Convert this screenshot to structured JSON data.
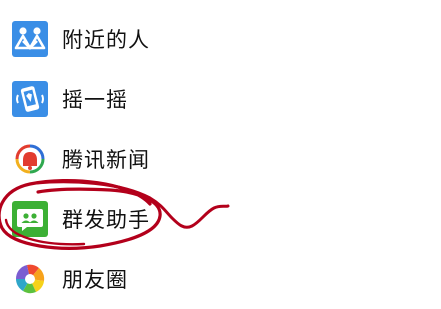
{
  "discover_menu": {
    "items": [
      {
        "label": "附近的人",
        "icon": "people-nearby-icon"
      },
      {
        "label": "摇一摇",
        "icon": "shake-icon"
      },
      {
        "label": "腾讯新闻",
        "icon": "tencent-news-icon"
      },
      {
        "label": "群发助手",
        "icon": "mass-message-assistant-icon"
      },
      {
        "label": "朋友圈",
        "icon": "moments-icon"
      }
    ]
  },
  "colors": {
    "blue_icon": "#3a8ee6",
    "green_icon": "#3cb035",
    "annotation_red": "#b3001b",
    "divider": "#e3e3e3"
  }
}
